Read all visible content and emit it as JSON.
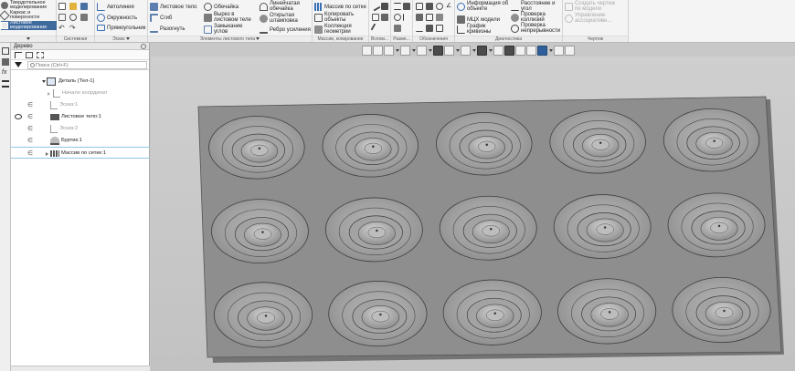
{
  "ribbon": {
    "modes": [
      {
        "label": "Твердотельное моделирование",
        "active": false
      },
      {
        "label": "Каркас и поверхности",
        "active": false
      },
      {
        "label": "Листовое моделирование",
        "active": true
      }
    ],
    "group_system": {
      "footer": "Системная"
    },
    "group_sketch": {
      "footer": "Эскиз",
      "autoline": "Автолиния",
      "circle": "Окружность",
      "rectangle": "Прямоугольник"
    },
    "group_sheet": {
      "footer": "Элементы листового тела",
      "sheet_body": "Листовое тело",
      "bend": "Сгиб",
      "unfold": "Разогнуть",
      "shell": "Обечайка",
      "cutout": "Вырез в листовом теле",
      "closure": "Замыкание углов",
      "linear_shell": "Линейчатая обечайка",
      "open_stamp": "Открытая штамповка",
      "rib": "Ребро усиления"
    },
    "group_array": {
      "footer": "Массив, копирование",
      "grid_array": "Массив по сетке",
      "copy_objects": "Копировать объекты",
      "geometry_collection": "Коллекция геометрии"
    },
    "group_aux": {
      "footer": "Вспом..."
    },
    "group_dims": {
      "footer": "Разме..."
    },
    "group_marks": {
      "footer": "Обозначения"
    },
    "group_diag": {
      "footer": "Диагностика",
      "object_info": "Информация об объекте",
      "mcc": "МЦХ модели",
      "curve_graph": "График кривизны",
      "distance_angle": "Расстояние и угол",
      "check_collisions": "Проверка коллизий",
      "check_continuity": "Проверка непрерывности"
    },
    "group_drawing": {
      "footer": "Чертеж",
      "create_drawing": "Создать чертеж по модели",
      "assoc_views": "Управление ассоциативн..."
    }
  },
  "tree": {
    "title": "Дерево",
    "search_placeholder": "Поиск (Ctrl+F)",
    "rows": [
      {
        "label": "Деталь (Тел-1)"
      },
      {
        "label": "Начало координат"
      },
      {
        "label": "Эскиз:1"
      },
      {
        "label": "Листовое тело:1"
      },
      {
        "label": "Эскиз:2"
      },
      {
        "label": "Буртик:1"
      },
      {
        "label": "Массив по сетке:1"
      }
    ]
  },
  "model": {
    "rows": 3,
    "cols": 5,
    "plate_color": "#8e8e8e",
    "cup_color": "#a3a3a3"
  }
}
